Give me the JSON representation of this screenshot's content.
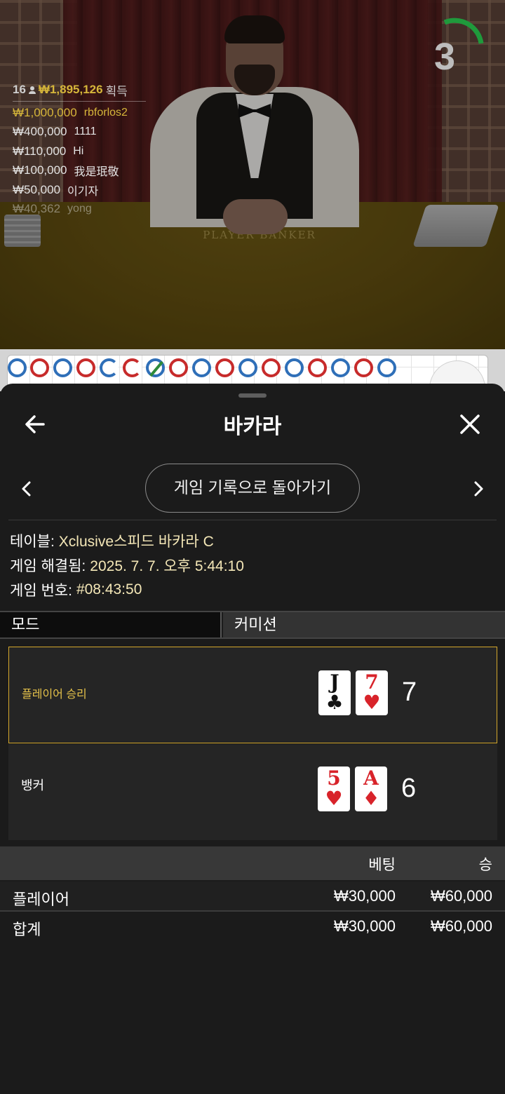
{
  "stream": {
    "timer": "3",
    "felt_text": "PLAYER    BANKER",
    "winners": {
      "count": "16",
      "total": "₩1,895,126",
      "total_label": "획득",
      "rows": [
        {
          "amount": "₩1,000,000",
          "name": "rbforlos2"
        },
        {
          "amount": "₩400,000",
          "name": "1111"
        },
        {
          "amount": "₩110,000",
          "name": "Hi"
        },
        {
          "amount": "₩100,000",
          "name": "我是珉敬"
        },
        {
          "amount": "₩50,000",
          "name": "이기자"
        },
        {
          "amount": "₩40,362",
          "name": "yong"
        }
      ]
    },
    "timer_color": "#1f9a3c"
  },
  "sheet": {
    "title": "바카라",
    "back_to_history": "게임 기록으로 돌아가기",
    "info": {
      "table_label": "테이블:",
      "table_value": "Xclusive스피드 바카라 C",
      "resolved_label": "게임 해결됨:",
      "resolved_value": "2025. 7. 7. 오후 5:44:10",
      "number_label": "게임 번호:",
      "number_value": "#08:43:50"
    },
    "tabs": {
      "mode": "모드",
      "commission": "커미션"
    },
    "player": {
      "label": "플레이어 승리",
      "cards": [
        {
          "rank": "J",
          "suit": "♣",
          "color": "black"
        },
        {
          "rank": "7",
          "suit": "♥",
          "color": "red"
        }
      ],
      "score": "7"
    },
    "banker": {
      "label": "뱅커",
      "cards": [
        {
          "rank": "5",
          "suit": "♥",
          "color": "red"
        },
        {
          "rank": "A",
          "suit": "♦",
          "color": "red"
        }
      ],
      "score": "6"
    },
    "bets": {
      "header_bet": "베팅",
      "header_win": "승",
      "rows": [
        {
          "label": "플레이어",
          "bet": "₩30,000",
          "win": "₩60,000"
        },
        {
          "label": "합계",
          "bet": "₩30,000",
          "win": "₩60,000"
        }
      ]
    }
  },
  "colors": {
    "accent_gold": "#d4a82c",
    "info_value": "#f4e7b7",
    "player_blue": "#2f6fb8",
    "banker_red": "#c72b2b"
  }
}
